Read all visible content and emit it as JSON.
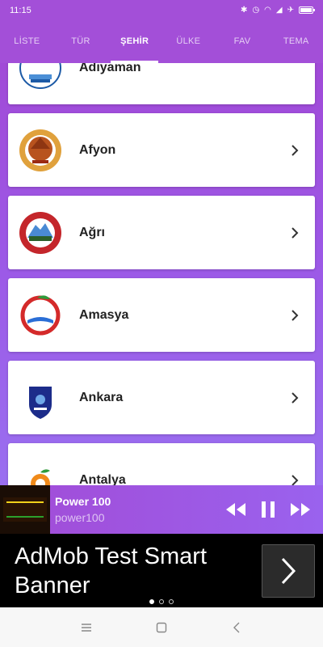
{
  "status_bar": {
    "time": "11:15",
    "icons": [
      "bluetooth-icon",
      "alarm-icon",
      "wifi-icon",
      "signal-icon",
      "battery-icon"
    ]
  },
  "tabs": [
    {
      "label": "LİSTE",
      "active": false
    },
    {
      "label": "TÜR",
      "active": false
    },
    {
      "label": "ŞEHİR",
      "active": true
    },
    {
      "label": "ÜLKE",
      "active": false
    },
    {
      "label": "FAV",
      "active": false
    },
    {
      "label": "TEMA",
      "active": false
    }
  ],
  "cities": [
    {
      "name": "Adıyaman",
      "logo": "adiyaman-logo"
    },
    {
      "name": "Afyon",
      "logo": "afyon-logo"
    },
    {
      "name": "Ağrı",
      "logo": "agri-logo"
    },
    {
      "name": "Amasya",
      "logo": "amasya-logo"
    },
    {
      "name": "Ankara",
      "logo": "ankara-logo"
    },
    {
      "name": "Antalya",
      "logo": "antalya-logo"
    }
  ],
  "player": {
    "station": "Power 100",
    "subtitle": "power100",
    "logo_text": "POWER"
  },
  "ad": {
    "text": "AdMob Test Smart Banner",
    "dots": 3,
    "active_dot": 0
  },
  "colors": {
    "accent": "#a34fd8",
    "card": "#ffffff",
    "ad_bg": "#000000"
  }
}
